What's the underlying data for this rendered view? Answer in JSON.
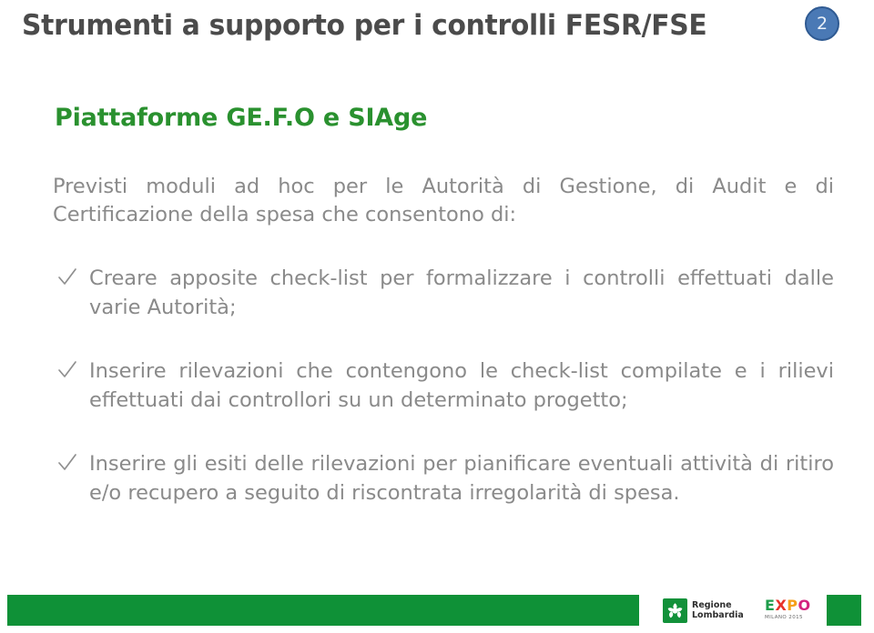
{
  "slide": {
    "title": "Strumenti a supporto per i controlli FESR/FSE",
    "page_number": "2",
    "subtitle": "Piattaforme GE.F.O e SIAge",
    "intro_paragraph": "Previsti moduli ad hoc per le Autorità di Gestione, di Audit e di Certificazione della spesa che consentono di:",
    "bullets": [
      "Creare apposite  check-list per formalizzare i controlli effettuati dalle varie Autorità;",
      "Inserire rilevazioni che contengono le check-list compilate e i rilievi effettuati dai controllori su un determinato progetto;",
      "Inserire gli esiti delle rilevazioni per pianificare eventuali attività di ritiro e/o recupero a seguito di riscontrata irregolarità di spesa."
    ],
    "bullet_marker": "check-icon"
  },
  "footer": {
    "logo_regione_line1": "Regione",
    "logo_regione_line2": "Lombardia",
    "logo_expo_letters": [
      "E",
      "X",
      "P",
      "O"
    ],
    "logo_expo_sub": "MILANO 2015"
  },
  "colors": {
    "title": "#4b4b4b",
    "subtitle_green": "#2a912f",
    "body_gray": "#8a8a8a",
    "badge_blue": "#4a79b5",
    "badge_border": "#2f5a92",
    "footer_green": "#0f9137"
  }
}
